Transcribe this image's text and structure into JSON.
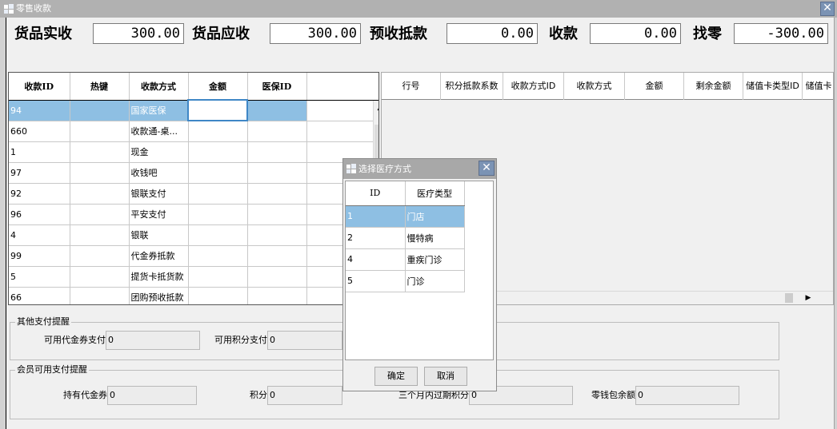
{
  "window": {
    "title": "零售收款",
    "close_glyph": "✕",
    "icon": "app-logo-icon"
  },
  "totals": [
    {
      "label": "货品实收",
      "value": "300.00"
    },
    {
      "label": "货品应收",
      "value": "300.00"
    },
    {
      "label": "预收抵款",
      "value": "0.00"
    },
    {
      "label": "收款",
      "value": "0.00"
    },
    {
      "label": "找零",
      "value": "-300.00"
    }
  ],
  "left_grid": {
    "columns": [
      "收款ID",
      "热键",
      "收款方式",
      "金额",
      "医保ID"
    ],
    "rows": [
      {
        "id": "94",
        "hotkey": "",
        "method": "国家医保",
        "amount": "",
        "insurance_id": ""
      },
      {
        "id": "660",
        "hotkey": "",
        "method": "收款通-桌...",
        "amount": "",
        "insurance_id": ""
      },
      {
        "id": "1",
        "hotkey": "",
        "method": "现金",
        "amount": "",
        "insurance_id": ""
      },
      {
        "id": "97",
        "hotkey": "",
        "method": "收钱吧",
        "amount": "",
        "insurance_id": ""
      },
      {
        "id": "92",
        "hotkey": "",
        "method": "银联支付",
        "amount": "",
        "insurance_id": ""
      },
      {
        "id": "96",
        "hotkey": "",
        "method": "平安支付",
        "amount": "",
        "insurance_id": ""
      },
      {
        "id": "4",
        "hotkey": "",
        "method": "银联",
        "amount": "",
        "insurance_id": ""
      },
      {
        "id": "99",
        "hotkey": "",
        "method": "代金券抵款",
        "amount": "",
        "insurance_id": ""
      },
      {
        "id": "5",
        "hotkey": "",
        "method": "提货卡抵货款",
        "amount": "",
        "insurance_id": ""
      },
      {
        "id": "66",
        "hotkey": "",
        "method": "团购预收抵款",
        "amount": "",
        "insurance_id": ""
      }
    ],
    "scroll_up_glyph": "▲"
  },
  "right_grid": {
    "columns": [
      "行号",
      "积分抵款系数",
      "收款方式ID",
      "收款方式",
      "金额",
      "剩余金额",
      "储值卡类型ID",
      "储值卡"
    ],
    "scroll_right_glyph": "▶"
  },
  "other_pay": {
    "title": "其他支付提醒",
    "voucher_label": "可用代金券支付",
    "voucher_value": "0",
    "points_label": "可用积分支付",
    "points_value": "0"
  },
  "member_pay": {
    "title": "会员可用支付提醒",
    "held_voucher_label": "持有代金券",
    "held_voucher_value": "0",
    "points_label": "积分",
    "points_value": "0",
    "expiring_label": "三个月内过期积分",
    "expiring_value": "0",
    "wallet_label": "零钱包余额",
    "wallet_value": "0"
  },
  "dialog": {
    "title": "选择医疗方式",
    "close_glyph": "✕",
    "columns": [
      "ID",
      "医疗类型"
    ],
    "rows": [
      {
        "id": "1",
        "type": "门店"
      },
      {
        "id": "2",
        "type": "慢特病"
      },
      {
        "id": "4",
        "type": "重疾门诊"
      },
      {
        "id": "5",
        "type": "门诊"
      }
    ],
    "ok_label": "确定",
    "cancel_label": "取消"
  },
  "colors": {
    "selection": "#8ebfe3",
    "title_bar": "#b1b1b1",
    "close_button": "#7b93b4"
  }
}
